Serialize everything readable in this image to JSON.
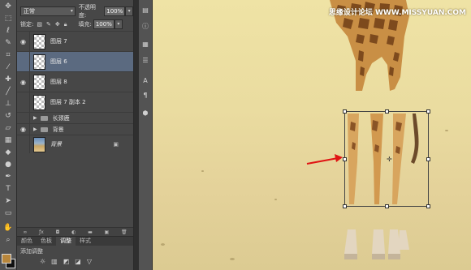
{
  "tools": [
    "move-icon",
    "marquee-icon",
    "lasso-icon",
    "quick-select-icon",
    "crop-icon",
    "eyedropper-icon",
    "healing-icon",
    "brush-icon",
    "stamp-icon",
    "history-brush-icon",
    "eraser-icon",
    "gradient-icon",
    "blur-icon",
    "dodge-icon",
    "pen-icon",
    "type-icon",
    "path-select-icon",
    "shape-icon",
    "hand-icon",
    "zoom-icon"
  ],
  "layers_panel": {
    "blend_mode": "正常",
    "opacity_label": "不透明度:",
    "opacity_value": "100%",
    "lock_label": "锁定:",
    "fill_label": "填充:",
    "fill_value": "100%",
    "layers": [
      {
        "name": "图层 7",
        "visible": true,
        "selected": false,
        "thumb": "checker"
      },
      {
        "name": "图层 6",
        "visible": false,
        "selected": true,
        "thumb": "checker"
      },
      {
        "name": "图层 8",
        "visible": true,
        "selected": false,
        "thumb": "checker"
      },
      {
        "name": "图层 7 副本 2",
        "visible": false,
        "selected": false,
        "thumb": "checker"
      },
      {
        "name": "长颈鹿",
        "visible": false,
        "type": "group"
      },
      {
        "name": "背景",
        "visible": true,
        "type": "group"
      },
      {
        "name": "背景",
        "visible": false,
        "selected": false,
        "thumb": "bg",
        "italic": true,
        "locked": true
      }
    ]
  },
  "panel_tabs": [
    "颜色",
    "色板",
    "调整",
    "样式"
  ],
  "active_tab": "调整",
  "adjust_title": "添加调整",
  "watermark": "思缘设计论坛 WWW.MISSYUAN.COM",
  "colors": {
    "foreground": "#b8863b",
    "background": "#111111",
    "selection": "#5b6a80"
  }
}
